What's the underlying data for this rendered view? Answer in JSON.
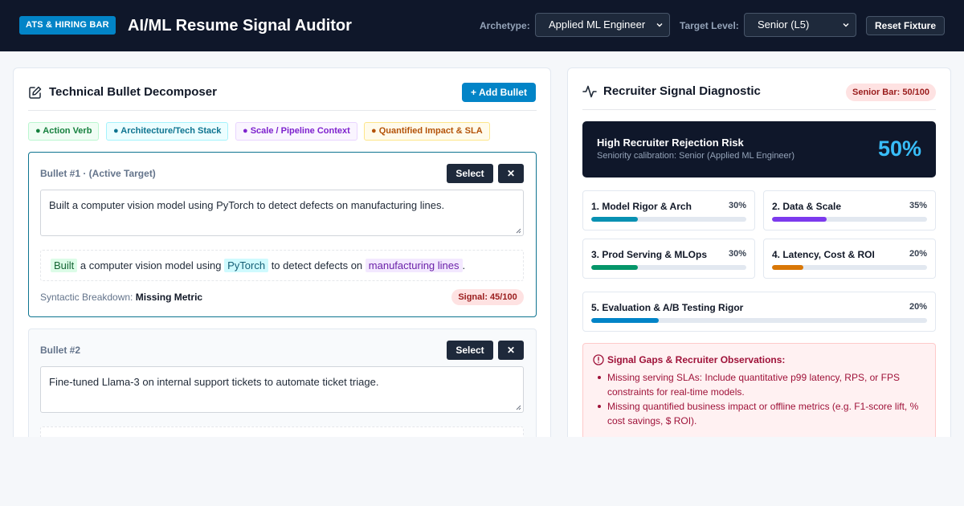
{
  "header": {
    "badge": "ATS & HIRING BAR",
    "title": "AI/ML Resume Signal Auditor",
    "archetype_label": "Archetype:",
    "archetype_value": "Applied ML Engineer",
    "level_label": "Target Level:",
    "level_value": "Senior (L5)",
    "reset_label": "Reset Fixture"
  },
  "left": {
    "title": "Technical Bullet Decomposer",
    "add_label": "+ Add Bullet",
    "legend": [
      {
        "label": "● Action Verb",
        "color": "#15803d"
      },
      {
        "label": "● Architecture/Tech Stack",
        "color": "#0e7490"
      },
      {
        "label": "● Scale / Pipeline Context",
        "color": "#7e22ce"
      },
      {
        "label": "● Quantified Impact & SLA",
        "color": "#b45309"
      }
    ],
    "bullets": [
      {
        "heading": "Bullet #1 · (Active Target)",
        "select_label": "Select",
        "remove_label": "✕",
        "text": "Built a computer vision model using PyTorch to detect defects on manufacturing lines.",
        "segments": {
          "verb": "Built",
          "t1": " a computer vision model using ",
          "tech": "PyTorch",
          "t2": " to detect defects on ",
          "scale": "manufacturing lines",
          "t3": "."
        },
        "breakdown_label": "Syntactic Breakdown:",
        "breakdown_value": "Missing Metric",
        "signal": "Signal: 45/100"
      },
      {
        "heading": "Bullet #2",
        "select_label": "Select",
        "remove_label": "✕",
        "text": "Fine-tuned Llama-3 on internal support tickets to automate ticket triage."
      }
    ]
  },
  "right": {
    "title": "Recruiter Signal Diagnostic",
    "senior_bar": "Senior Bar: 50/100",
    "risk": {
      "title": "High Recruiter Rejection Risk",
      "subtitle": "Seniority calibration: Senior (Applied ML Engineer)",
      "percent": "50%"
    },
    "metrics": [
      {
        "name": "1. Model Rigor & Arch",
        "pct": "30%",
        "value": 30,
        "color": "#0891b2"
      },
      {
        "name": "2. Data & Scale",
        "pct": "35%",
        "value": 35,
        "color": "#7c3aed"
      },
      {
        "name": "3. Prod Serving & MLOps",
        "pct": "30%",
        "value": 30,
        "color": "#059669"
      },
      {
        "name": "4. Latency, Cost & ROI",
        "pct": "20%",
        "value": 20,
        "color": "#d97706"
      },
      {
        "name": "5. Evaluation & A/B Testing Rigor",
        "pct": "20%",
        "value": 20,
        "color": "#0284c7"
      }
    ],
    "gaps": {
      "title": "Signal Gaps & Recruiter Observations:",
      "items": [
        "Missing serving SLAs: Include quantitative p99 latency, RPS, or FPS constraints for real-time models.",
        "Missing quantified business impact or offline metrics (e.g. F1-score lift, % cost savings, $ ROI)."
      ]
    }
  }
}
